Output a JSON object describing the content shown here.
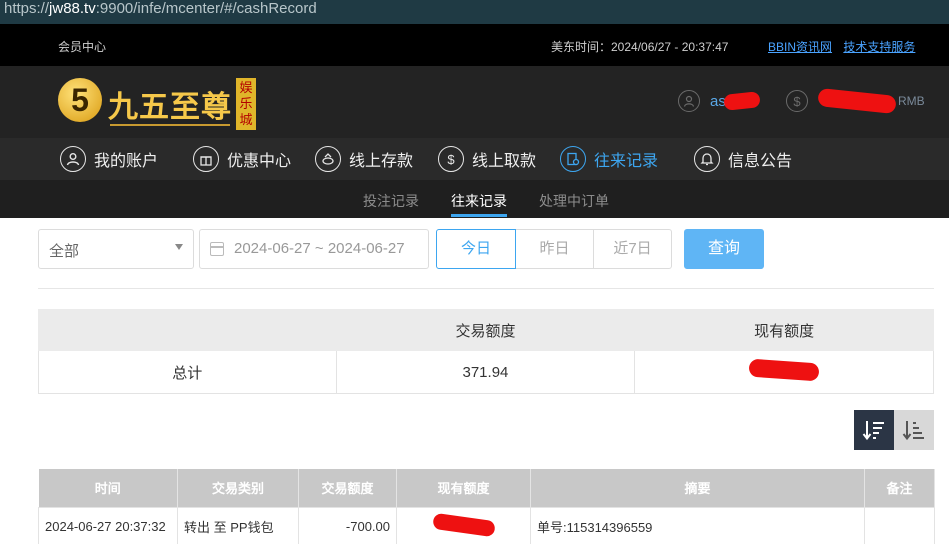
{
  "url": {
    "protocol": "https://",
    "host": "jw88.tv",
    "rest": ":9900/infe/mcenter/#/cashRecord"
  },
  "topbar": {
    "member_center": "会员中心",
    "time_label": "美东时间：2024/06/27 - 20:37:47",
    "link_bbin": "BBIN资讯网",
    "link_support": "技术支持服务"
  },
  "brand": {
    "logo_char": "5",
    "name": "九五至尊",
    "tag": "娱乐城"
  },
  "account": {
    "username_visible": "as",
    "currency": "RMB"
  },
  "nav": [
    {
      "label": "我的账户",
      "icon": "user-icon"
    },
    {
      "label": "优惠中心",
      "icon": "gift-icon"
    },
    {
      "label": "线上存款",
      "icon": "deposit-icon"
    },
    {
      "label": "线上取款",
      "icon": "withdraw-icon"
    },
    {
      "label": "往来记录",
      "icon": "record-icon",
      "active": true
    },
    {
      "label": "信息公告",
      "icon": "bell-icon"
    }
  ],
  "subnav": [
    {
      "label": "投注记录"
    },
    {
      "label": "往来记录",
      "active": true
    },
    {
      "label": "处理中订单"
    }
  ],
  "filter": {
    "type_selected": "全部",
    "date_range": "2024-06-27 ~ 2024-06-27",
    "quick": [
      "今日",
      "昨日",
      "近7日"
    ],
    "query": "查询"
  },
  "summary": {
    "headers": [
      "",
      "交易额度",
      "现有额度"
    ],
    "row_label": "总计",
    "amount": "371.94"
  },
  "records": {
    "headers": [
      "时间",
      "交易类别",
      "交易额度",
      "现有额度",
      "摘要",
      "备注"
    ],
    "rows": [
      {
        "time": "2024-06-27 20:37:32",
        "type": "转出 至 PP钱包",
        "amount": "-700.00",
        "balance": "",
        "summary": "单号:115314396559",
        "note": ""
      }
    ]
  },
  "colors": {
    "accent": "#3da6f0",
    "redact": "#ee1111"
  }
}
